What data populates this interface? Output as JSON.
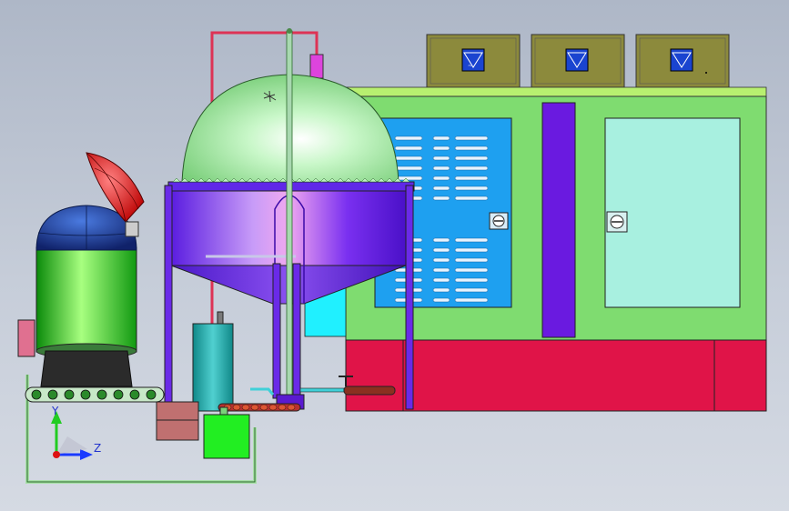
{
  "triad": {
    "y_label": "Y",
    "z_label": "Z"
  },
  "colors": {
    "background_top": "#aeb7c7",
    "background_bottom": "#d5dae3",
    "cabinet_green": "#7fdc70",
    "cabinet_red": "#e01448",
    "panel_blue": "#1ea0f0",
    "door_cyan": "#a8f0e0",
    "divider_purple": "#6a1ae0",
    "tank_purple": "#7a30f0",
    "dome_green": "#a8f0a8",
    "furnace_green": "#22cc22",
    "furnace_dome_blue": "#1a3a9a",
    "lid_red": "#dd1111",
    "box_olive": "#8c8a3c",
    "pipe_red": "#dd3355",
    "pipe_cyan": "#40d0d8"
  }
}
